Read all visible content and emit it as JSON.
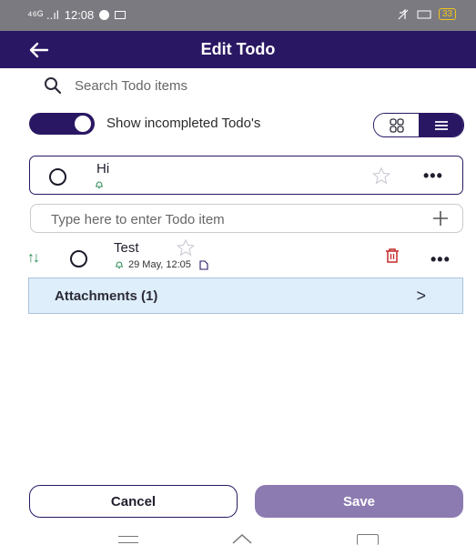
{
  "status_bar": {
    "network": "⁴⁶ᴳ ..ıl",
    "time": "12:08",
    "battery": "33"
  },
  "app_bar": {
    "title": "Edit Todo",
    "back_icon": "arrow-left-icon"
  },
  "search": {
    "placeholder": "Search Todo items",
    "icon": "search-icon"
  },
  "filter": {
    "toggle_label": "Show incompleted Todo's",
    "toggle_on": true,
    "view_mode": "list"
  },
  "todos": [
    {
      "title": "Hi",
      "has_reminder": true,
      "starred": false
    }
  ],
  "add_item": {
    "placeholder": "Type here to enter Todo item"
  },
  "sub_item": {
    "title": "Test",
    "reminder": "29 May, 12:05",
    "starred": false
  },
  "attachments": {
    "label": "Attachments (1)",
    "chevron": ">"
  },
  "footer": {
    "cancel_label": "Cancel",
    "save_label": "Save"
  },
  "colors": {
    "primary": "#2a1763",
    "save_button": "#8c7bb0",
    "attachment_bg": "#dfeefb",
    "bell": "#2e8b57",
    "trash": "#c62828"
  }
}
